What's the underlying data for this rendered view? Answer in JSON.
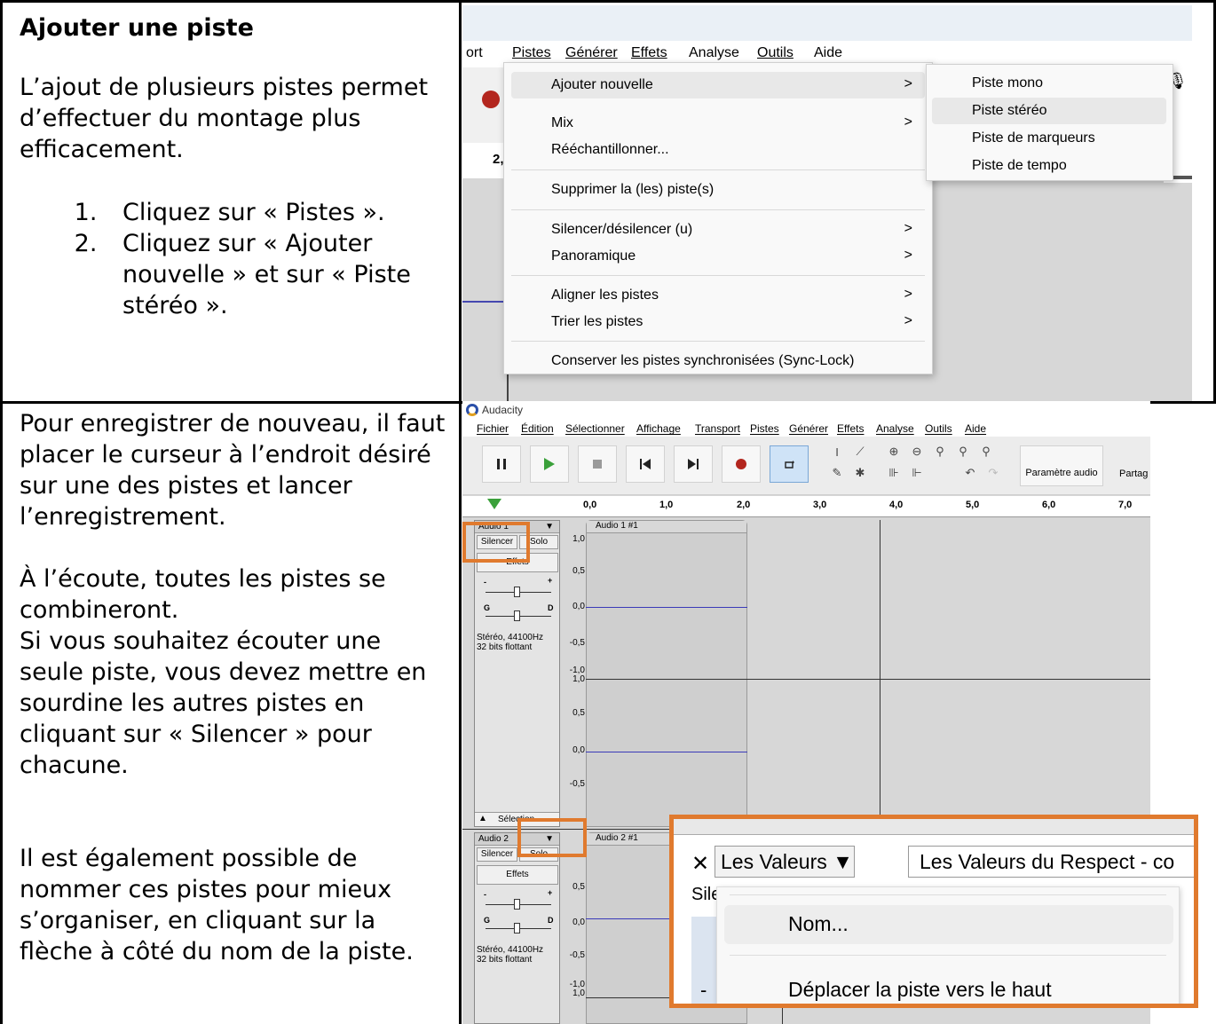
{
  "section1": {
    "title": "Ajouter une piste",
    "intro": "L’ajout de plusieurs pistes permet d’effectuer du montage plus efficacement.",
    "steps": [
      "Cliquez sur « Pistes ».",
      "Cliquez sur « Ajouter nouvelle » et sur « Piste stéréo »."
    ]
  },
  "section2": {
    "para1": "Pour enregistrer de nouveau, il faut placer le curseur à l’endroit désiré sur une des pistes et lancer l’enregistrement.",
    "para2a": "À l’écoute, toutes les pistes se combineront.",
    "para2b": "Si vous souhaitez écouter une seule piste, vous devez mettre en sourdine les autres pistes en cliquant sur « Silencer » pour chacune.",
    "para3": "Il est également possible de nommer ces pistes pour mieux s’organiser, en cliquant sur la flèche à côté du nom de la piste."
  },
  "shot1": {
    "menubar": [
      "ort",
      "Pistes",
      "Générer",
      "Effets",
      "Analyse",
      "Outils",
      "Aide"
    ],
    "ruler_value": "2,",
    "menu_items": [
      "Ajouter nouvelle",
      "Mix",
      "Rééchantillonner...",
      "Supprimer la (les) piste(s)",
      "Silencer/désilencer (u)",
      "Panoramique",
      "Aligner les pistes",
      "Trier les pistes",
      "Conserver les pistes synchronisées (Sync-Lock)"
    ],
    "arrow": ">",
    "submenu_items": [
      "Piste mono",
      "Piste stéréo",
      "Piste de marqueurs",
      "Piste de tempo"
    ],
    "mic_glyph": "🎙"
  },
  "shot2": {
    "app_title": "Audacity",
    "menubar": [
      "Fichier",
      "Édition",
      "Sélectionner",
      "Affichage",
      "Transport",
      "Pistes",
      "Générer",
      "Effets",
      "Analyse",
      "Outils",
      "Aide"
    ],
    "param_audio": "Paramètre audio",
    "partage": "Partag",
    "ruler_ticks": [
      "0,0",
      "1,0",
      "2,0",
      "3,0",
      "4,0",
      "5,0",
      "6,0",
      "7,0"
    ],
    "track1": {
      "name": "Audio 1",
      "clip": "Audio 1 #1",
      "silencer": "Silencer",
      "solo": "Solo",
      "effets": "Effets",
      "info1": "Stéréo, 44100Hz",
      "info2": "32 bits flottant",
      "selection": "Sélection"
    },
    "track2": {
      "name": "Audio 2",
      "clip": "Audio 2 #1",
      "silencer": "Silencer",
      "solo": "Solo",
      "effets": "Effets",
      "info1": "Stéréo, 44100Hz",
      "info2": "32 bits flottant"
    },
    "scale": [
      "1,0",
      "0,5",
      "0,0",
      "-0,5",
      "-1,0"
    ],
    "minus": "-",
    "plus": "+",
    "g": "G",
    "d": "D"
  },
  "zoom": {
    "close": "✕",
    "track_name": "Les Valeurs ▼",
    "field": "Les Valeurs du Respect - co",
    "sile": "Sile",
    "menu_nom": "Nom...",
    "menu_move_up": "Déplacer la piste vers le haut",
    "minus": "-"
  },
  "colors": {
    "accent": "#e07a2e",
    "record": "#b3261e",
    "wave": "#3a3ab8",
    "play": "#3aa03a"
  }
}
